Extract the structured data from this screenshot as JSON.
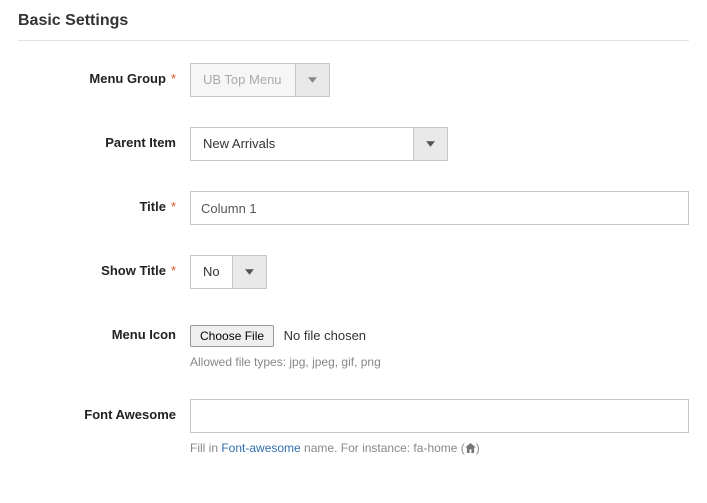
{
  "section": {
    "title": "Basic Settings"
  },
  "fields": {
    "menu_group": {
      "label": "Menu Group",
      "value": "UB Top Menu",
      "required": true
    },
    "parent_item": {
      "label": "Parent Item",
      "value": "New Arrivals",
      "required": false
    },
    "title": {
      "label": "Title",
      "value": "Column 1",
      "required": true
    },
    "show_title": {
      "label": "Show Title",
      "value": "No",
      "required": true
    },
    "menu_icon": {
      "label": "Menu Icon",
      "button": "Choose File",
      "status": "No file chosen",
      "hint": "Allowed file types: jpg, jpeg, gif, png"
    },
    "font_awesome": {
      "label": "Font Awesome",
      "value": "",
      "hint_prefix": "Fill in ",
      "hint_link": "Font-awesome",
      "hint_suffix_a": " name. For instance: fa-home (",
      "hint_suffix_b": ")"
    }
  }
}
